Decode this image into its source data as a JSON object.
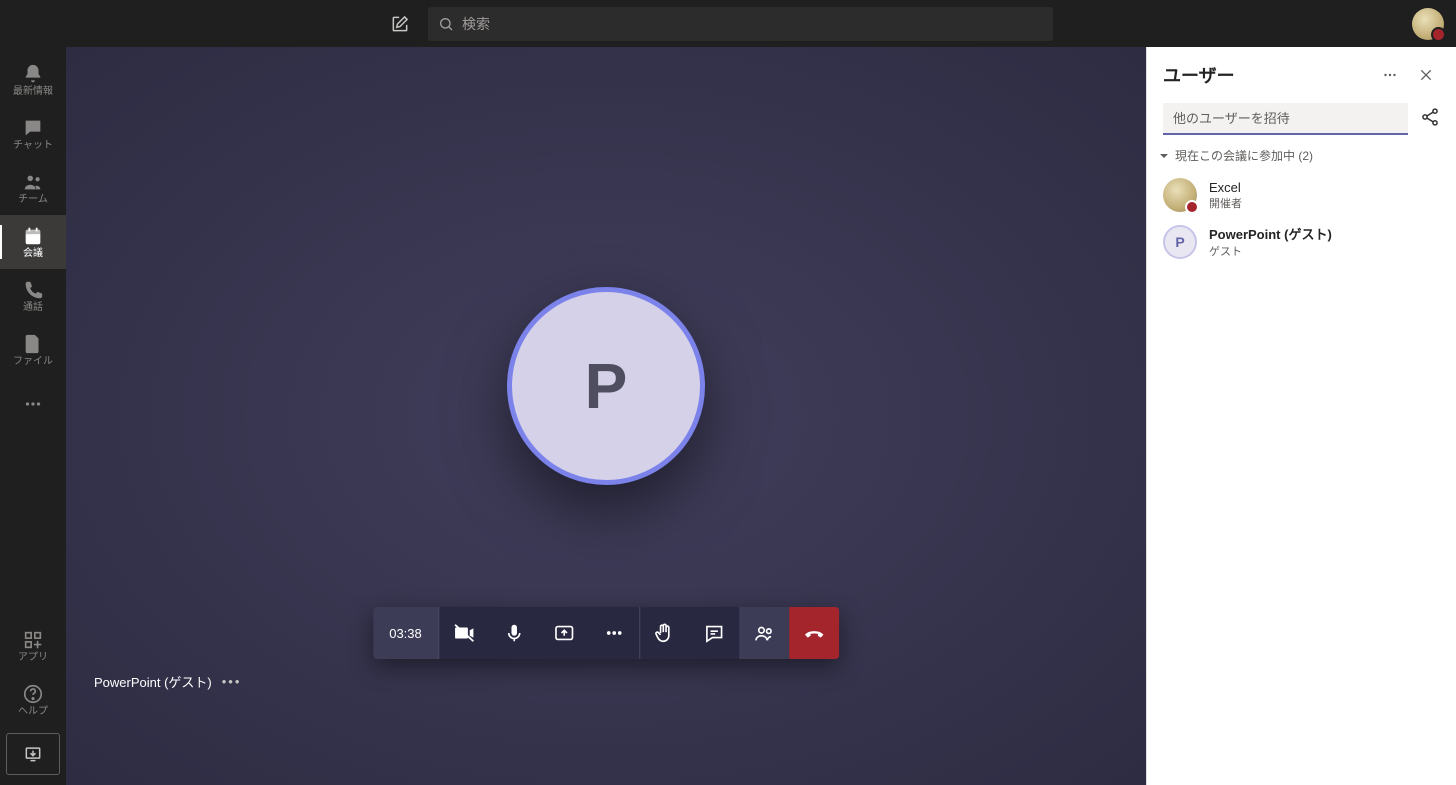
{
  "search": {
    "placeholder": "検索"
  },
  "rail": {
    "items": [
      {
        "id": "activity",
        "label": "最新情報"
      },
      {
        "id": "chat",
        "label": "チャット"
      },
      {
        "id": "teams",
        "label": "チーム"
      },
      {
        "id": "calendar",
        "label": "会議"
      },
      {
        "id": "calls",
        "label": "通話"
      },
      {
        "id": "files",
        "label": "ファイル"
      }
    ],
    "apps_label": "アプリ",
    "help_label": "ヘルプ"
  },
  "meeting": {
    "speaker_initial": "P",
    "caller_label": "PowerPoint (ゲスト)",
    "timer": "03:38"
  },
  "panel": {
    "title": "ユーザー",
    "invite_placeholder": "他のユーザーを招待",
    "section_label": "現在この会議に参加中  (2)",
    "participants": [
      {
        "name": "Excel",
        "role": "開催者",
        "avatar": "img",
        "bold": false
      },
      {
        "name": "PowerPoint (ゲスト)",
        "role": "ゲスト",
        "avatar": "letter",
        "initial": "P",
        "bold": true
      }
    ]
  }
}
